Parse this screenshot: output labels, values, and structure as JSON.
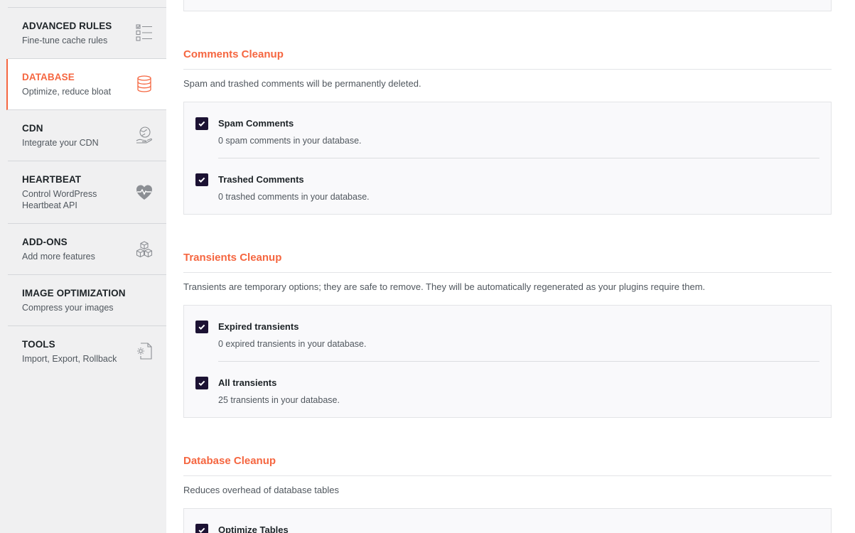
{
  "sidebar": {
    "items": [
      {
        "title": "ADVANCED RULES",
        "subtitle": "Fine-tune cache rules",
        "icon": "checklist-icon"
      },
      {
        "title": "DATABASE",
        "subtitle": "Optimize, reduce bloat",
        "icon": "database-icon"
      },
      {
        "title": "CDN",
        "subtitle": "Integrate your CDN",
        "icon": "globe-hand-icon"
      },
      {
        "title": "HEARTBEAT",
        "subtitle": "Control WordPress Heartbeat API",
        "icon": "heartbeat-icon"
      },
      {
        "title": "ADD-ONS",
        "subtitle": "Add more features",
        "icon": "cubes-icon"
      },
      {
        "title": "IMAGE OPTIMIZATION",
        "subtitle": "Compress your images",
        "icon": ""
      },
      {
        "title": "TOOLS",
        "subtitle": "Import, Export, Rollback",
        "icon": "gear-document-icon"
      }
    ]
  },
  "sections": {
    "comments": {
      "title": "Comments Cleanup",
      "description": "Spam and trashed comments will be permanently deleted.",
      "options": [
        {
          "label": "Spam Comments",
          "detail": "0 spam comments in your database.",
          "checked": true
        },
        {
          "label": "Trashed Comments",
          "detail": "0 trashed comments in your database.",
          "checked": true
        }
      ]
    },
    "transients": {
      "title": "Transients Cleanup",
      "description": "Transients are temporary options; they are safe to remove. They will be automatically regenerated as your plugins require them.",
      "options": [
        {
          "label": "Expired transients",
          "detail": "0 expired transients in your database.",
          "checked": true
        },
        {
          "label": "All transients",
          "detail": "25 transients in your database.",
          "checked": true
        }
      ]
    },
    "database": {
      "title": "Database Cleanup",
      "description": "Reduces overhead of database tables",
      "options": [
        {
          "label": "Optimize Tables",
          "checked": true
        }
      ]
    }
  },
  "colors": {
    "accent": "#f56640",
    "checkbox": "#1c1233",
    "sidebar_bg": "#f0f0f1",
    "box_bg": "#f9f9fb"
  }
}
